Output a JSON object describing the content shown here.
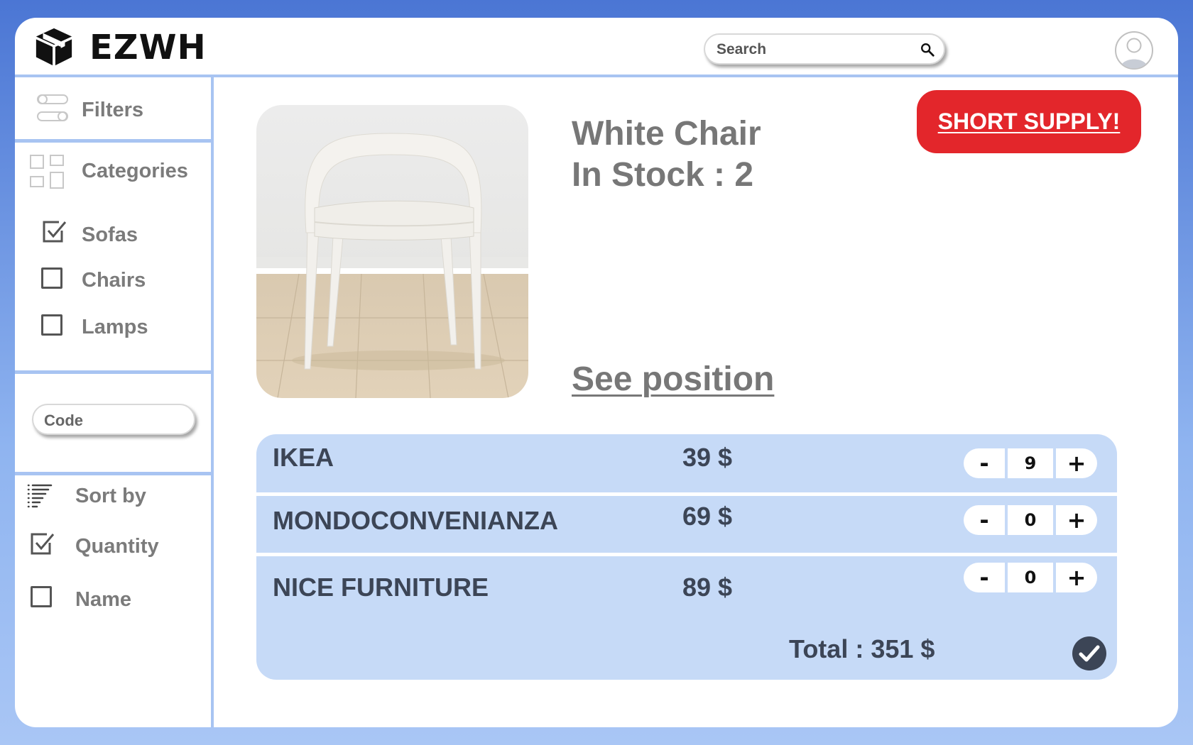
{
  "header": {
    "app_name": "EZWH",
    "logo_icon": "box-icon",
    "search": {
      "placeholder": "Search",
      "icon": "search-icon"
    },
    "avatar_icon": "user-avatar-icon"
  },
  "sidebar": {
    "filters": {
      "label": "Filters",
      "icon": "toggles-icon"
    },
    "categories": {
      "label": "Categories",
      "icon": "grid-icon",
      "items": [
        {
          "label": "Sofas",
          "checked": true
        },
        {
          "label": "Chairs",
          "checked": false
        },
        {
          "label": "Lamps",
          "checked": false
        }
      ]
    },
    "code": {
      "placeholder": "Code"
    },
    "sort": {
      "label": "Sort by",
      "icon": "list-icon",
      "items": [
        {
          "label": "Quantity",
          "checked": true
        },
        {
          "label": "Name",
          "checked": false
        }
      ]
    }
  },
  "product": {
    "name": "White Chair",
    "stock_text": "In Stock : 2",
    "see_position": "See position",
    "alert": "SHORT SUPPLY!",
    "alert_color": "#e3262b"
  },
  "suppliers": [
    {
      "name": "IKEA",
      "price": "39 $",
      "minus": "-",
      "quantity": "9",
      "plus": "+"
    },
    {
      "name": "MONDOCONVENIANZA",
      "price": "69 $",
      "minus": "-",
      "quantity": "0",
      "plus": "+"
    },
    {
      "name": "NICE FURNITURE",
      "price": "89 $",
      "minus": "-",
      "quantity": "0",
      "plus": "+"
    }
  ],
  "total_text": "Total : 351 $",
  "confirm_icon": "check-circle-icon",
  "colors": {
    "accent": "#a8c4f2",
    "panel": "#c6daf7",
    "text_dark": "#3c4556",
    "text_gray": "#7b7b7b"
  }
}
